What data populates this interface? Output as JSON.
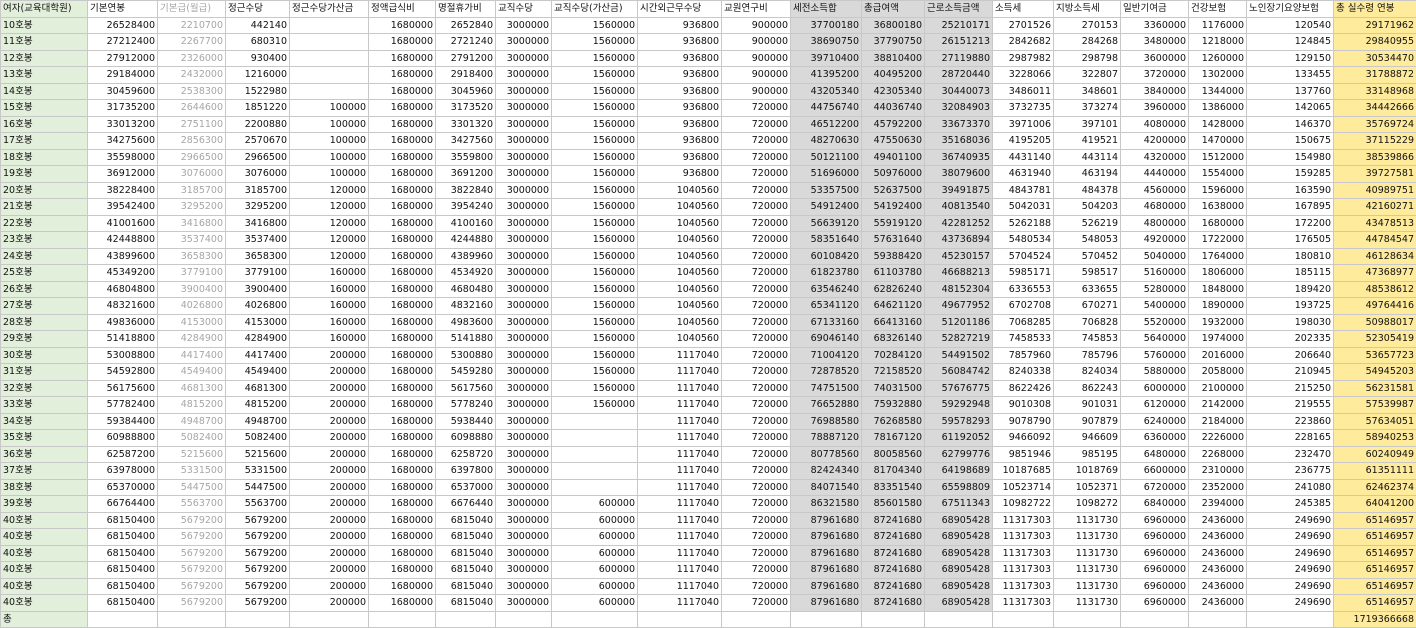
{
  "headers": [
    "여자(교육대학원)",
    "기본연봉",
    "기본급(월급)",
    "정근수당",
    "정근수당가산금",
    "정액급식비",
    "명절휴가비",
    "교직수당",
    "교직수당(가산금)",
    "시간외근무수당",
    "교원연구비",
    "세전소득합",
    "총급여액",
    "근로소득금액",
    "소득세",
    "지방소득세",
    "일반기여금",
    "건강보험",
    "노인장기요양보험",
    "총 실수령 연봉"
  ],
  "rows": [
    [
      "10호봉",
      "26528400",
      "2210700",
      "442140",
      "",
      "1680000",
      "2652840",
      "3000000",
      "1560000",
      "936800",
      "900000",
      "37700180",
      "36800180",
      "25210171",
      "2701526",
      "270153",
      "3360000",
      "1176000",
      "120540",
      "29171962"
    ],
    [
      "11호봉",
      "27212400",
      "2267700",
      "680310",
      "",
      "1680000",
      "2721240",
      "3000000",
      "1560000",
      "936800",
      "900000",
      "38690750",
      "37790750",
      "26151213",
      "2842682",
      "284268",
      "3480000",
      "1218000",
      "124845",
      "29840955"
    ],
    [
      "12호봉",
      "27912000",
      "2326000",
      "930400",
      "",
      "1680000",
      "2791200",
      "3000000",
      "1560000",
      "936800",
      "900000",
      "39710400",
      "38810400",
      "27119880",
      "2987982",
      "298798",
      "3600000",
      "1260000",
      "129150",
      "30534470"
    ],
    [
      "13호봉",
      "29184000",
      "2432000",
      "1216000",
      "",
      "1680000",
      "2918400",
      "3000000",
      "1560000",
      "936800",
      "900000",
      "41395200",
      "40495200",
      "28720440",
      "3228066",
      "322807",
      "3720000",
      "1302000",
      "133455",
      "31788872"
    ],
    [
      "14호봉",
      "30459600",
      "2538300",
      "1522980",
      "",
      "1680000",
      "3045960",
      "3000000",
      "1560000",
      "936800",
      "900000",
      "43205340",
      "42305340",
      "30440073",
      "3486011",
      "348601",
      "3840000",
      "1344000",
      "137760",
      "33148968"
    ],
    [
      "15호봉",
      "31735200",
      "2644600",
      "1851220",
      "100000",
      "1680000",
      "3173520",
      "3000000",
      "1560000",
      "936800",
      "720000",
      "44756740",
      "44036740",
      "32084903",
      "3732735",
      "373274",
      "3960000",
      "1386000",
      "142065",
      "34442666"
    ],
    [
      "16호봉",
      "33013200",
      "2751100",
      "2200880",
      "100000",
      "1680000",
      "3301320",
      "3000000",
      "1560000",
      "936800",
      "720000",
      "46512200",
      "45792200",
      "33673370",
      "3971006",
      "397101",
      "4080000",
      "1428000",
      "146370",
      "35769724"
    ],
    [
      "17호봉",
      "34275600",
      "2856300",
      "2570670",
      "100000",
      "1680000",
      "3427560",
      "3000000",
      "1560000",
      "936800",
      "720000",
      "48270630",
      "47550630",
      "35168036",
      "4195205",
      "419521",
      "4200000",
      "1470000",
      "150675",
      "37115229"
    ],
    [
      "18호봉",
      "35598000",
      "2966500",
      "2966500",
      "100000",
      "1680000",
      "3559800",
      "3000000",
      "1560000",
      "936800",
      "720000",
      "50121100",
      "49401100",
      "36740935",
      "4431140",
      "443114",
      "4320000",
      "1512000",
      "154980",
      "38539866"
    ],
    [
      "19호봉",
      "36912000",
      "3076000",
      "3076000",
      "100000",
      "1680000",
      "3691200",
      "3000000",
      "1560000",
      "936800",
      "720000",
      "51696000",
      "50976000",
      "38079600",
      "4631940",
      "463194",
      "4440000",
      "1554000",
      "159285",
      "39727581"
    ],
    [
      "20호봉",
      "38228400",
      "3185700",
      "3185700",
      "120000",
      "1680000",
      "3822840",
      "3000000",
      "1560000",
      "1040560",
      "720000",
      "53357500",
      "52637500",
      "39491875",
      "4843781",
      "484378",
      "4560000",
      "1596000",
      "163590",
      "40989751"
    ],
    [
      "21호봉",
      "39542400",
      "3295200",
      "3295200",
      "120000",
      "1680000",
      "3954240",
      "3000000",
      "1560000",
      "1040560",
      "720000",
      "54912400",
      "54192400",
      "40813540",
      "5042031",
      "504203",
      "4680000",
      "1638000",
      "167895",
      "42160271"
    ],
    [
      "22호봉",
      "41001600",
      "3416800",
      "3416800",
      "120000",
      "1680000",
      "4100160",
      "3000000",
      "1560000",
      "1040560",
      "720000",
      "56639120",
      "55919120",
      "42281252",
      "5262188",
      "526219",
      "4800000",
      "1680000",
      "172200",
      "43478513"
    ],
    [
      "23호봉",
      "42448800",
      "3537400",
      "3537400",
      "120000",
      "1680000",
      "4244880",
      "3000000",
      "1560000",
      "1040560",
      "720000",
      "58351640",
      "57631640",
      "43736894",
      "5480534",
      "548053",
      "4920000",
      "1722000",
      "176505",
      "44784547"
    ],
    [
      "24호봉",
      "43899600",
      "3658300",
      "3658300",
      "120000",
      "1680000",
      "4389960",
      "3000000",
      "1560000",
      "1040560",
      "720000",
      "60108420",
      "59388420",
      "45230157",
      "5704524",
      "570452",
      "5040000",
      "1764000",
      "180810",
      "46128634"
    ],
    [
      "25호봉",
      "45349200",
      "3779100",
      "3779100",
      "160000",
      "1680000",
      "4534920",
      "3000000",
      "1560000",
      "1040560",
      "720000",
      "61823780",
      "61103780",
      "46688213",
      "5985171",
      "598517",
      "5160000",
      "1806000",
      "185115",
      "47368977"
    ],
    [
      "26호봉",
      "46804800",
      "3900400",
      "3900400",
      "160000",
      "1680000",
      "4680480",
      "3000000",
      "1560000",
      "1040560",
      "720000",
      "63546240",
      "62826240",
      "48152304",
      "6336553",
      "633655",
      "5280000",
      "1848000",
      "189420",
      "48538612"
    ],
    [
      "27호봉",
      "48321600",
      "4026800",
      "4026800",
      "160000",
      "1680000",
      "4832160",
      "3000000",
      "1560000",
      "1040560",
      "720000",
      "65341120",
      "64621120",
      "49677952",
      "6702708",
      "670271",
      "5400000",
      "1890000",
      "193725",
      "49764416"
    ],
    [
      "28호봉",
      "49836000",
      "4153000",
      "4153000",
      "160000",
      "1680000",
      "4983600",
      "3000000",
      "1560000",
      "1040560",
      "720000",
      "67133160",
      "66413160",
      "51201186",
      "7068285",
      "706828",
      "5520000",
      "1932000",
      "198030",
      "50988017"
    ],
    [
      "29호봉",
      "51418800",
      "4284900",
      "4284900",
      "160000",
      "1680000",
      "5141880",
      "3000000",
      "1560000",
      "1040560",
      "720000",
      "69046140",
      "68326140",
      "52827219",
      "7458533",
      "745853",
      "5640000",
      "1974000",
      "202335",
      "52305419"
    ],
    [
      "30호봉",
      "53008800",
      "4417400",
      "4417400",
      "200000",
      "1680000",
      "5300880",
      "3000000",
      "1560000",
      "1117040",
      "720000",
      "71004120",
      "70284120",
      "54491502",
      "7857960",
      "785796",
      "5760000",
      "2016000",
      "206640",
      "53657723"
    ],
    [
      "31호봉",
      "54592800",
      "4549400",
      "4549400",
      "200000",
      "1680000",
      "5459280",
      "3000000",
      "1560000",
      "1117040",
      "720000",
      "72878520",
      "72158520",
      "56084742",
      "8240338",
      "824034",
      "5880000",
      "2058000",
      "210945",
      "54945203"
    ],
    [
      "32호봉",
      "56175600",
      "4681300",
      "4681300",
      "200000",
      "1680000",
      "5617560",
      "3000000",
      "1560000",
      "1117040",
      "720000",
      "74751500",
      "74031500",
      "57676775",
      "8622426",
      "862243",
      "6000000",
      "2100000",
      "215250",
      "56231581"
    ],
    [
      "33호봉",
      "57782400",
      "4815200",
      "4815200",
      "200000",
      "1680000",
      "5778240",
      "3000000",
      "1560000",
      "1117040",
      "720000",
      "76652880",
      "75932880",
      "59292948",
      "9010308",
      "901031",
      "6120000",
      "2142000",
      "219555",
      "57539987"
    ],
    [
      "34호봉",
      "59384400",
      "4948700",
      "4948700",
      "200000",
      "1680000",
      "5938440",
      "3000000",
      "",
      "1117040",
      "720000",
      "76988580",
      "76268580",
      "59578293",
      "9078790",
      "907879",
      "6240000",
      "2184000",
      "223860",
      "57634051"
    ],
    [
      "35호봉",
      "60988800",
      "5082400",
      "5082400",
      "200000",
      "1680000",
      "6098880",
      "3000000",
      "",
      "1117040",
      "720000",
      "78887120",
      "78167120",
      "61192052",
      "9466092",
      "946609",
      "6360000",
      "2226000",
      "228165",
      "58940253"
    ],
    [
      "36호봉",
      "62587200",
      "5215600",
      "5215600",
      "200000",
      "1680000",
      "6258720",
      "3000000",
      "",
      "1117040",
      "720000",
      "80778560",
      "80058560",
      "62799776",
      "9851946",
      "985195",
      "6480000",
      "2268000",
      "232470",
      "60240949"
    ],
    [
      "37호봉",
      "63978000",
      "5331500",
      "5331500",
      "200000",
      "1680000",
      "6397800",
      "3000000",
      "",
      "1117040",
      "720000",
      "82424340",
      "81704340",
      "64198689",
      "10187685",
      "1018769",
      "6600000",
      "2310000",
      "236775",
      "61351111"
    ],
    [
      "38호봉",
      "65370000",
      "5447500",
      "5447500",
      "200000",
      "1680000",
      "6537000",
      "3000000",
      "",
      "1117040",
      "720000",
      "84071540",
      "83351540",
      "65598809",
      "10523714",
      "1052371",
      "6720000",
      "2352000",
      "241080",
      "62462374"
    ],
    [
      "39호봉",
      "66764400",
      "5563700",
      "5563700",
      "200000",
      "1680000",
      "6676440",
      "3000000",
      "600000",
      "1117040",
      "720000",
      "86321580",
      "85601580",
      "67511343",
      "10982722",
      "1098272",
      "6840000",
      "2394000",
      "245385",
      "64041200"
    ],
    [
      "40호봉",
      "68150400",
      "5679200",
      "5679200",
      "200000",
      "1680000",
      "6815040",
      "3000000",
      "600000",
      "1117040",
      "720000",
      "87961680",
      "87241680",
      "68905428",
      "11317303",
      "1131730",
      "6960000",
      "2436000",
      "249690",
      "65146957"
    ],
    [
      "40호봉",
      "68150400",
      "5679200",
      "5679200",
      "200000",
      "1680000",
      "6815040",
      "3000000",
      "600000",
      "1117040",
      "720000",
      "87961680",
      "87241680",
      "68905428",
      "11317303",
      "1131730",
      "6960000",
      "2436000",
      "249690",
      "65146957"
    ],
    [
      "40호봉",
      "68150400",
      "5679200",
      "5679200",
      "200000",
      "1680000",
      "6815040",
      "3000000",
      "600000",
      "1117040",
      "720000",
      "87961680",
      "87241680",
      "68905428",
      "11317303",
      "1131730",
      "6960000",
      "2436000",
      "249690",
      "65146957"
    ],
    [
      "40호봉",
      "68150400",
      "5679200",
      "5679200",
      "200000",
      "1680000",
      "6815040",
      "3000000",
      "600000",
      "1117040",
      "720000",
      "87961680",
      "87241680",
      "68905428",
      "11317303",
      "1131730",
      "6960000",
      "2436000",
      "249690",
      "65146957"
    ],
    [
      "40호봉",
      "68150400",
      "5679200",
      "5679200",
      "200000",
      "1680000",
      "6815040",
      "3000000",
      "600000",
      "1117040",
      "720000",
      "87961680",
      "87241680",
      "68905428",
      "11317303",
      "1131730",
      "6960000",
      "2436000",
      "249690",
      "65146957"
    ],
    [
      "40호봉",
      "68150400",
      "5679200",
      "5679200",
      "200000",
      "1680000",
      "6815040",
      "3000000",
      "600000",
      "1117040",
      "720000",
      "87961680",
      "87241680",
      "68905428",
      "11317303",
      "1131730",
      "6960000",
      "2436000",
      "249690",
      "65146957"
    ]
  ],
  "total": {
    "label": "총",
    "value": "1719366668"
  },
  "colors": {
    "label_bg": "#e2efda",
    "shaded_bg": "#d9d9d9",
    "highlight_bg": "#ffeb9c",
    "muted_text": "#a6a6a6"
  }
}
